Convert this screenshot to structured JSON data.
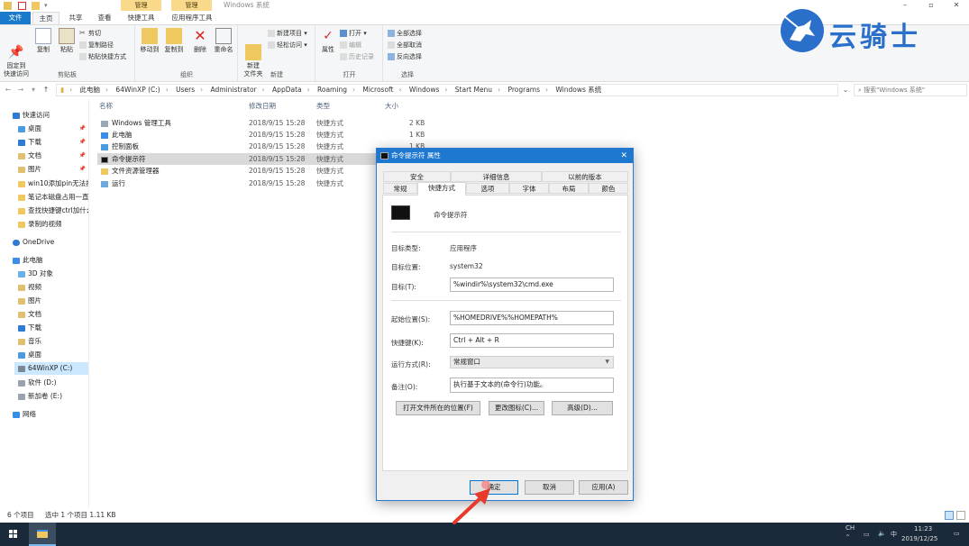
{
  "window": {
    "title": "Windows 系统",
    "context_tabs": [
      "管理",
      "管理"
    ]
  },
  "ribbon_tabs": [
    "文件",
    "主页",
    "共享",
    "查看",
    "快捷工具",
    "应用程序工具"
  ],
  "ribbon": {
    "clipboard": {
      "pin_label": "固定到\n快速访问",
      "copy_label": "复制",
      "paste_label": "粘贴",
      "cut_label": "剪切",
      "copy_path_label": "复制路径",
      "paste_shortcut_label": "粘贴快捷方式",
      "group_label": "剪贴板"
    },
    "organize": {
      "move_to_label": "移动到",
      "copy_to_label": "复制到",
      "delete_label": "删除",
      "rename_label": "重命名",
      "group_label": "组织"
    },
    "new": {
      "new_folder_label": "新建\n文件夹",
      "new_item_label": "新建项目",
      "easy_access_label": "轻松访问",
      "group_label": "新建"
    },
    "open": {
      "properties_label": "属性",
      "open_label": "打开",
      "edit_label": "编辑",
      "history_label": "历史记录",
      "group_label": "打开"
    },
    "select": {
      "select_all_label": "全部选择",
      "select_none_label": "全部取消",
      "invert_label": "反向选择",
      "group_label": "选择"
    }
  },
  "address": {
    "crumbs": [
      "此电脑",
      "64WinXP (C:)",
      "Users",
      "Administrator",
      "AppData",
      "Roaming",
      "Microsoft",
      "Windows",
      "Start Menu",
      "Programs",
      "Windows 系统"
    ],
    "search_placeholder": "搜索\"Windows 系统\""
  },
  "nav": {
    "quick_access": "快速访问",
    "pinned": [
      "桌面",
      "下载",
      "文档",
      "图片"
    ],
    "recent": [
      "win10添加pin无法打",
      "笔记本磁盘占用一直",
      "查找快捷键ctrl加什么",
      "录制的视频"
    ],
    "onedrive": "OneDrive",
    "this_pc": "此电脑",
    "pc_items": [
      "3D 对象",
      "视频",
      "图片",
      "文档",
      "下载",
      "音乐",
      "桌面"
    ],
    "drives": [
      "64WinXP (C:)",
      "软件 (D:)",
      "新加卷 (E:)"
    ],
    "network": "网络"
  },
  "list": {
    "columns": [
      "名称",
      "修改日期",
      "类型",
      "大小"
    ],
    "rows": [
      {
        "name": "Windows 管理工具",
        "date": "2018/9/15 15:28",
        "type": "快捷方式",
        "size": "2 KB"
      },
      {
        "name": "此电脑",
        "date": "2018/9/15 15:28",
        "type": "快捷方式",
        "size": "1 KB"
      },
      {
        "name": "控制面板",
        "date": "2018/9/15 15:28",
        "type": "快捷方式",
        "size": "1 KB"
      },
      {
        "name": "命令提示符",
        "date": "2018/9/15 15:28",
        "type": "快捷方式",
        "size": ""
      },
      {
        "name": "文件资源管理器",
        "date": "2018/9/15 15:28",
        "type": "快捷方式",
        "size": ""
      },
      {
        "name": "运行",
        "date": "2018/9/15 15:28",
        "type": "快捷方式",
        "size": ""
      }
    ]
  },
  "status": {
    "count": "6 个项目",
    "selection": "选中 1 个项目  1.11 KB"
  },
  "taskbar": {
    "ime": "CH",
    "time": "11:23",
    "date": "2019/12/25"
  },
  "dialog": {
    "title": "命令提示符 属性",
    "tabs_row1": [
      "安全",
      "详细信息",
      "以前的版本"
    ],
    "tabs_row2": [
      "常规",
      "快捷方式",
      "选项",
      "字体",
      "布局",
      "颜色"
    ],
    "app_name": "命令提示符",
    "target_type_label": "目标类型:",
    "target_type_value": "应用程序",
    "target_location_label": "目标位置:",
    "target_location_value": "system32",
    "target_label": "目标(T):",
    "target_value": "%windir%\\system32\\cmd.exe",
    "start_in_label": "起始位置(S):",
    "start_in_value": "%HOMEDRIVE%%HOMEPATH%",
    "shortcut_key_label": "快捷键(K):",
    "shortcut_key_value": "Ctrl + Alt + R",
    "run_label": "运行方式(R):",
    "run_value": "常规窗口",
    "comment_label": "备注(O):",
    "comment_value": "执行基于文本的(命令行)功能。",
    "open_location_button": "打开文件所在的位置(F)",
    "change_icon_button": "更改图标(C)...",
    "advanced_button": "高级(D)...",
    "ok_button": "确定",
    "cancel_button": "取消",
    "apply_button": "应用(A)"
  },
  "watermark": {
    "text": "云骑士"
  }
}
